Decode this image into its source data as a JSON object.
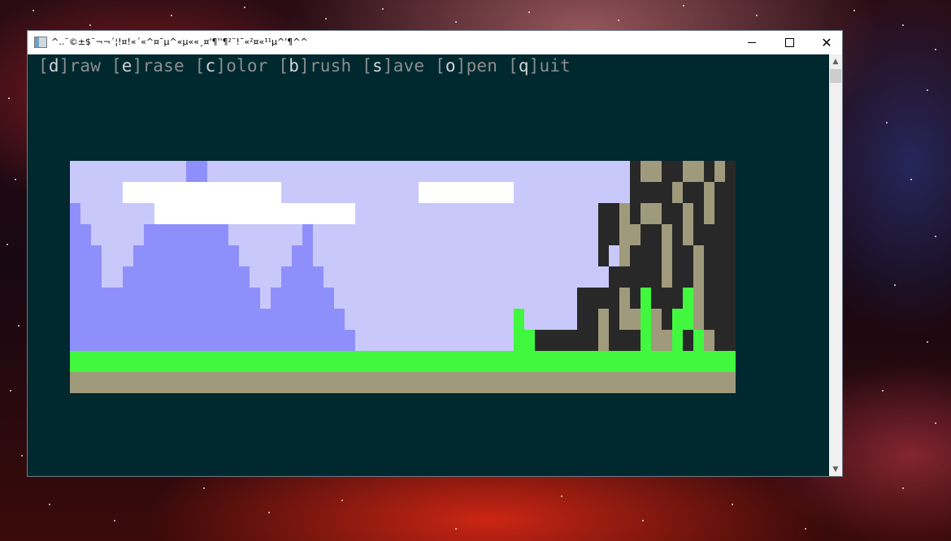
{
  "window": {
    "title": "^..¨©±$¨¬¬´¦!¤!«´«^¤¯µ^«µ««¸¤'¶''¶²¨!¯«²¤«¹¹µ^'¶^^"
  },
  "menu": {
    "items": [
      {
        "key": "d",
        "rest": "raw"
      },
      {
        "key": "e",
        "rest": "rase"
      },
      {
        "key": "c",
        "rest": "olor"
      },
      {
        "key": "b",
        "rest": "rush"
      },
      {
        "key": "s",
        "rest": "ave"
      },
      {
        "key": "o",
        "rest": "pen"
      },
      {
        "key": "q",
        "rest": "uit"
      }
    ]
  },
  "colors": {
    "terminal_bg": "#00282f",
    "sky": "#c9c8fb",
    "mountain": "#8f8ffb",
    "cloud": "#ffffff",
    "grass": "#41f83f",
    "dirt": "#a09a7c",
    "tree_dark": "#282828",
    "tree_light": "#a09a7c"
  },
  "icons": {
    "app": "console-window-icon",
    "minimize": "minimize-icon",
    "maximize": "maximize-icon",
    "close": "close-icon",
    "scroll_up": "chevron-up-icon",
    "scroll_down": "chevron-down-icon"
  }
}
